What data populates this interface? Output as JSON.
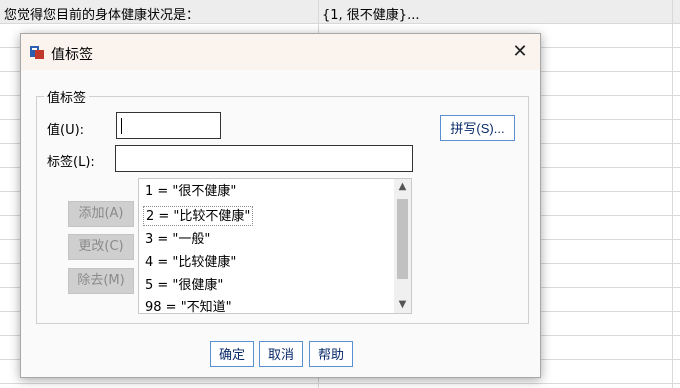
{
  "background": {
    "question_text": "您觉得您目前的身体健康状况是：",
    "value_labels_text": "{1, 很不健康}...",
    "row_count": 15
  },
  "dialog": {
    "title": "值标签",
    "close_glyph": "✕",
    "group_title": "值标签",
    "value_label": "值(U):",
    "label_label": "标签(L):",
    "value_input": "",
    "label_input": "",
    "spelling_button": "拼写(S)...",
    "add_button": "添加(A)",
    "change_button": "更改(C)",
    "remove_button": "除去(M)",
    "list_items": [
      "1 = \"很不健康\"",
      "2 = \"比较不健康\"",
      "3 = \"一般\"",
      "4 = \"比较健康\"",
      "5 = \"很健康\"",
      "98 = \"不知道\""
    ],
    "ok_button": "确定",
    "cancel_button": "取消",
    "help_button": "帮助",
    "scroll_up_glyph": "▲",
    "scroll_down_glyph": "▼"
  },
  "colors": {
    "accent_border": "#5a8fd4",
    "titlebar": "#fbf4ee"
  }
}
